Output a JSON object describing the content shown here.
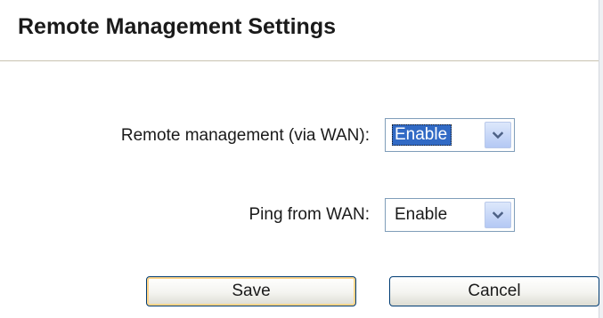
{
  "page": {
    "title": "Remote Management Settings"
  },
  "form": {
    "remote_management": {
      "label": "Remote management (via WAN):",
      "value": "Enable"
    },
    "ping_from_wan": {
      "label": "Ping from WAN:",
      "value": "Enable"
    }
  },
  "actions": {
    "save_label": "Save",
    "cancel_label": "Cancel"
  },
  "icons": {
    "dropdown": "chevron-down-icon"
  },
  "colors": {
    "selection_highlight": "#316ac5",
    "field_border": "#7f9db9",
    "button_border": "#003c74",
    "divider": "#c8c2b0"
  }
}
